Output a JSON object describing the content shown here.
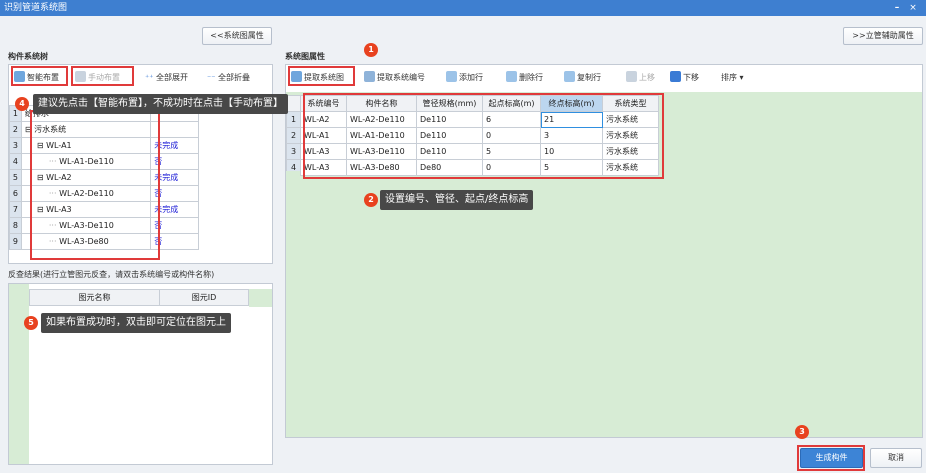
{
  "window": {
    "title": "识别管道系统图",
    "min_label": "–",
    "close_label": "×"
  },
  "toggle": {
    "left_label": "<<系统图属性",
    "right_label": ">>立管辅助属性"
  },
  "tree_panel": {
    "title": "构件系统树",
    "toolbar": {
      "smart": "智能布置",
      "manual": "手动布置",
      "expand": "全部展开",
      "collapse": "全部折叠"
    },
    "header_cell": "- 给排水",
    "rows": [
      {
        "num": "1",
        "name": "给排水",
        "status": ""
      },
      {
        "num": "2",
        "name": "污水系统",
        "status": ""
      },
      {
        "num": "3",
        "name": "WL-A1",
        "status": "未完成"
      },
      {
        "num": "4",
        "name": "WL-A1-De110",
        "status": "否"
      },
      {
        "num": "5",
        "name": "WL-A2",
        "status": "未完成"
      },
      {
        "num": "6",
        "name": "WL-A2-De110",
        "status": "否"
      },
      {
        "num": "7",
        "name": "WL-A3",
        "status": "未完成"
      },
      {
        "num": "8",
        "name": "WL-A3-De110",
        "status": "否"
      },
      {
        "num": "9",
        "name": "WL-A3-De80",
        "status": "否"
      }
    ]
  },
  "result_panel": {
    "title": "反查结果(进行立管图元反查，请双击系统编号或构件名称)",
    "col1": "图元名称",
    "col2": "图元ID"
  },
  "prop_panel": {
    "title": "系统图属性",
    "toolbar": {
      "extract": "提取系统图",
      "extract_code": "提取系统编号",
      "add": "添加行",
      "del": "删除行",
      "copy": "复制行",
      "up": "上移",
      "down": "下移",
      "sort": "排序"
    },
    "columns": [
      "",
      "系统编号",
      "构件名称",
      "管径规格(mm)",
      "起点标高(m)",
      "终点标高(m)",
      "系统类型"
    ],
    "rows": [
      {
        "num": "1",
        "code": "WL-A2",
        "name": "WL-A2-De110",
        "spec": "De110",
        "start": "6",
        "end": "21",
        "type": "污水系统"
      },
      {
        "num": "2",
        "code": "WL-A1",
        "name": "WL-A1-De110",
        "spec": "De110",
        "start": "0",
        "end": "3",
        "type": "污水系统"
      },
      {
        "num": "3",
        "code": "WL-A3",
        "name": "WL-A3-De110",
        "spec": "De110",
        "start": "5",
        "end": "10",
        "type": "污水系统"
      },
      {
        "num": "4",
        "code": "WL-A3",
        "name": "WL-A3-De80",
        "spec": "De80",
        "start": "0",
        "end": "5",
        "type": "污水系统"
      }
    ]
  },
  "buttons": {
    "generate": "生成构件",
    "cancel": "取消"
  },
  "tips": {
    "t2": "设置编号、管径、起点/终点标高",
    "t4": "建议先点击【智能布置】，不成功时在点击【手动布置】",
    "t5": "如果布置成功时，双击即可定位在图元上"
  },
  "badges": {
    "b1": "1",
    "b2": "2",
    "b3": "3",
    "b4": "4",
    "b5": "5"
  },
  "colors": {
    "title_bar": "#3e7fd0",
    "annotation_red": "#e03a3a",
    "badge": "#e8421f",
    "tip_bg": "#484848",
    "status_blue": "#1a1ad6",
    "generate_btn": "#3d84d6"
  }
}
